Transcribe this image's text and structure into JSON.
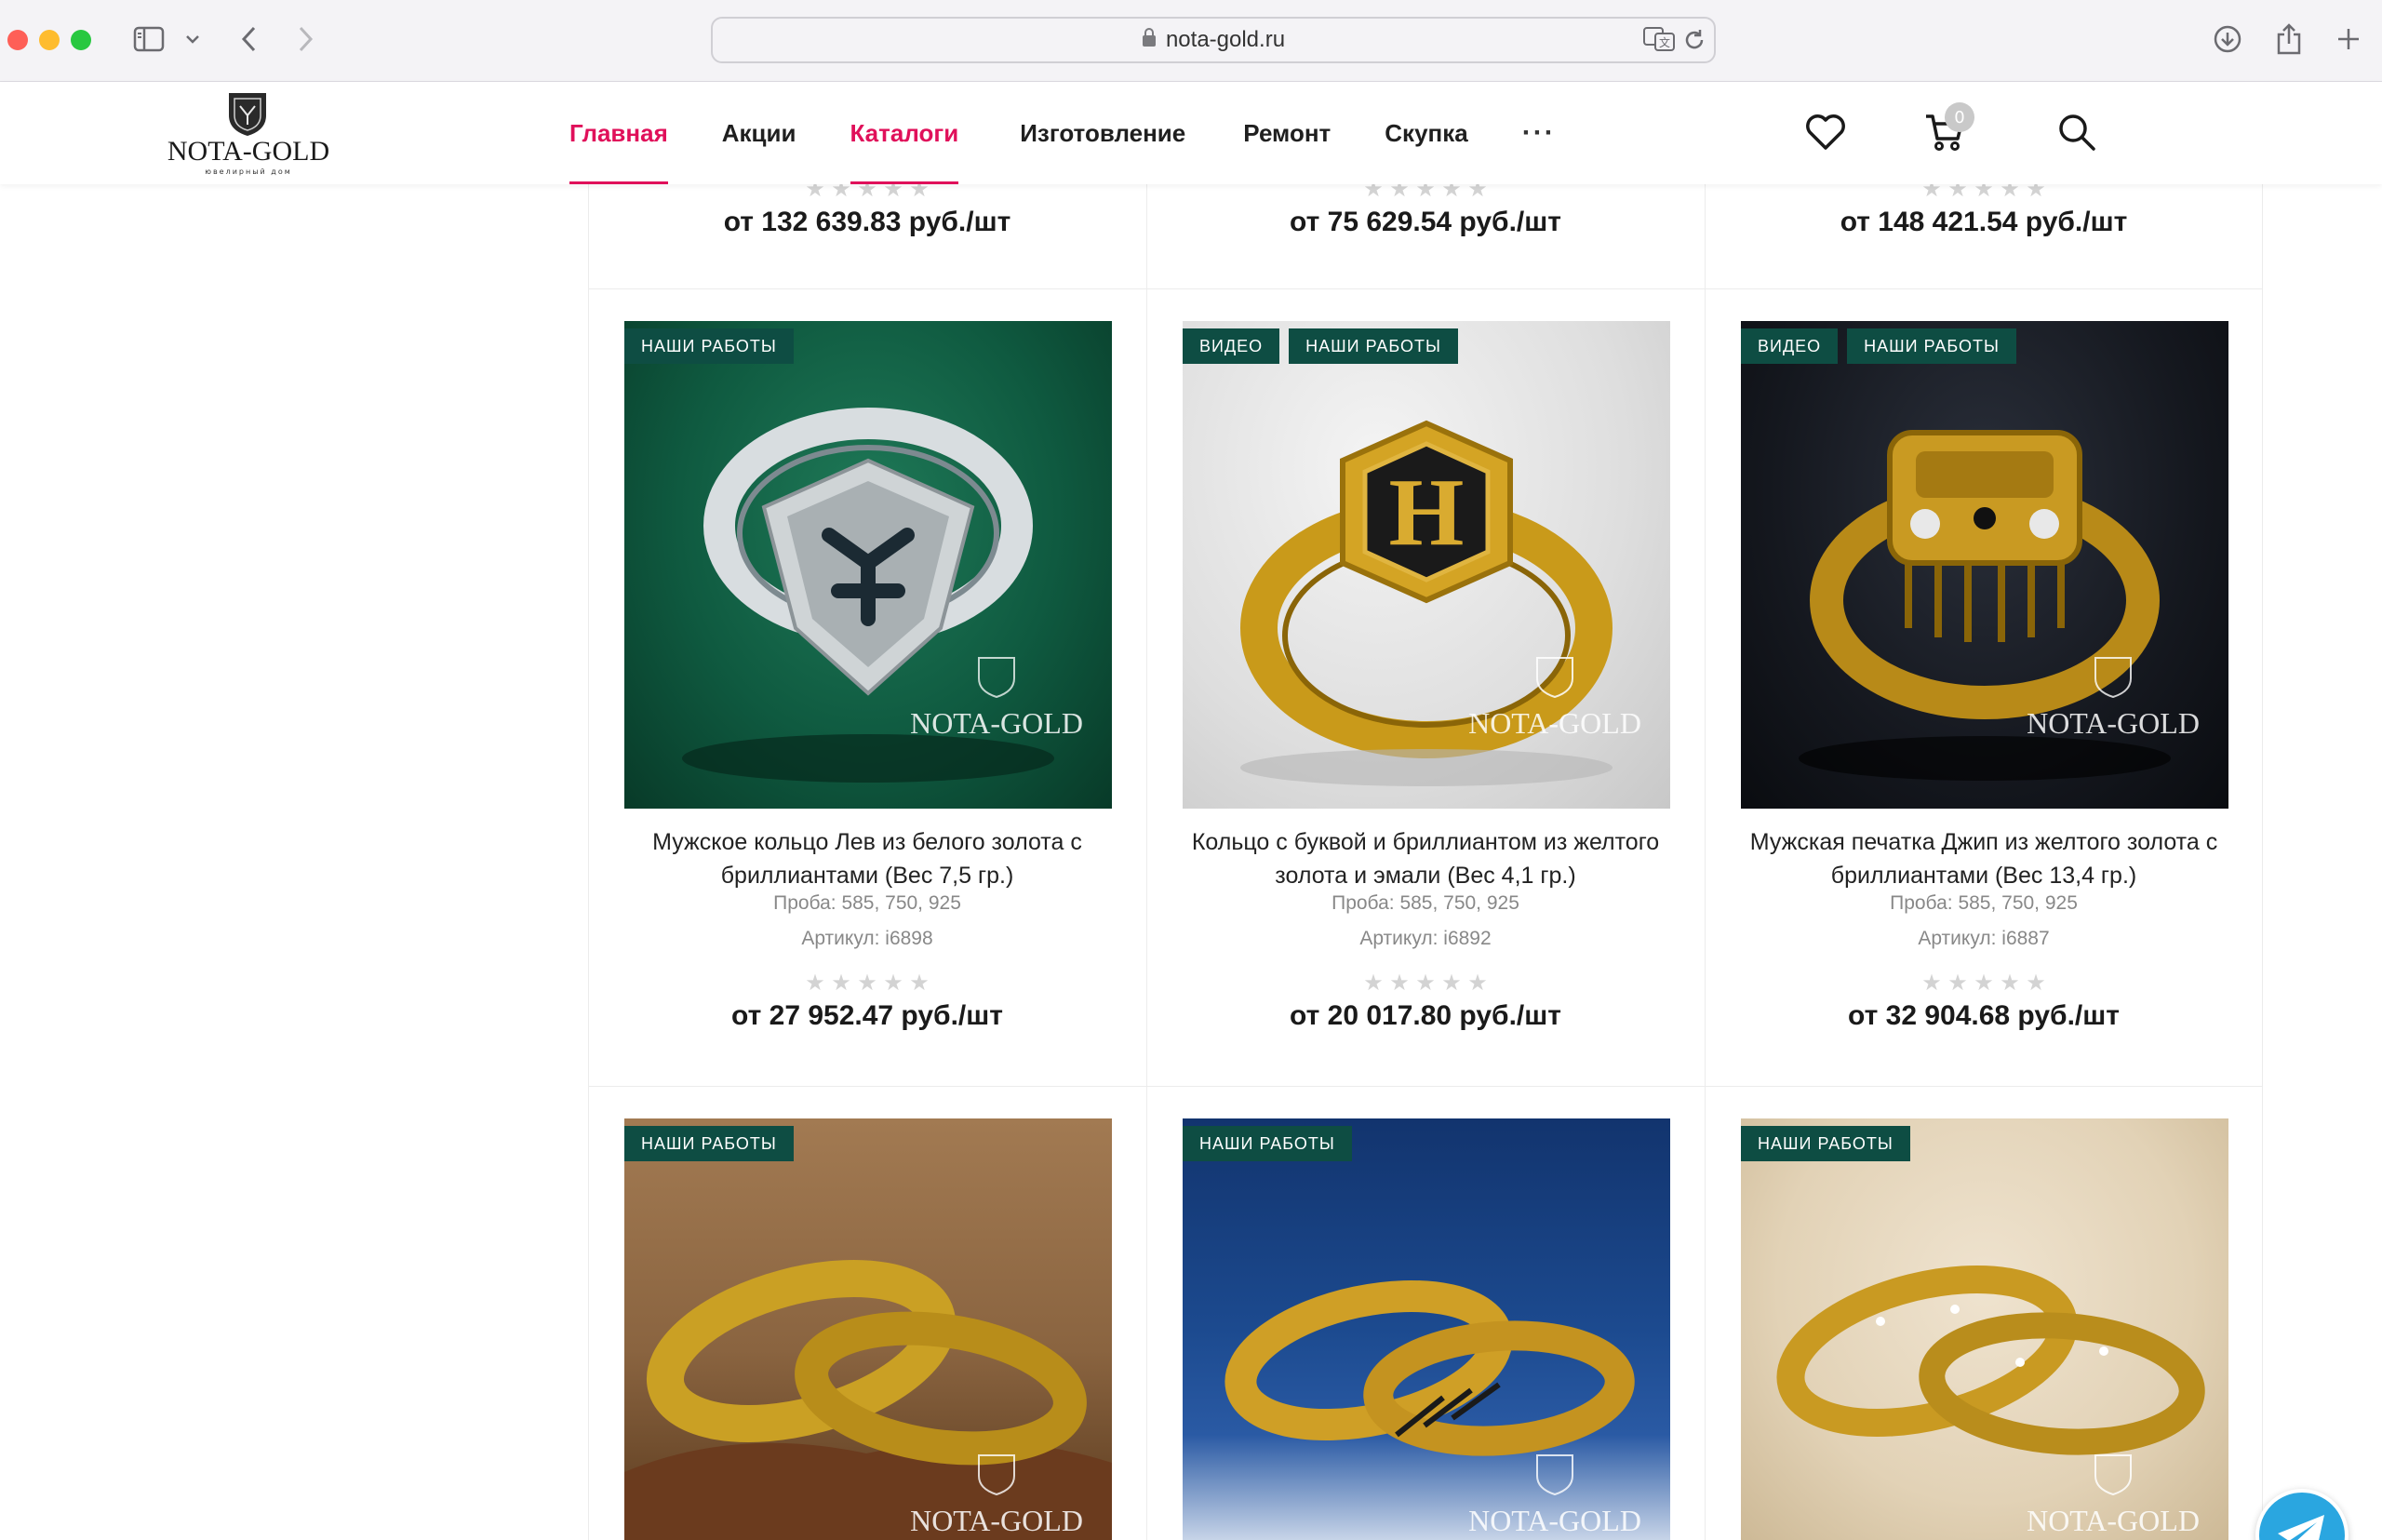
{
  "browser": {
    "url": "nota-gold.ru"
  },
  "header": {
    "logo": {
      "word": "NOTA-GOLD",
      "sub": "ювелирный дом"
    },
    "nav": [
      {
        "label": "Главная",
        "active": true
      },
      {
        "label": "Акции",
        "active": false
      },
      {
        "label": "Каталоги",
        "active": true
      },
      {
        "label": "Изготовление",
        "active": false
      },
      {
        "label": "Ремонт",
        "active": false
      },
      {
        "label": "Скупка",
        "active": false
      }
    ],
    "more": "···",
    "cart_count": "0"
  },
  "prev_prices": [
    "от 132 639.83 руб./шт",
    "от 75 629.54 руб./шт",
    "от 148 421.54 руб./шт"
  ],
  "products": [
    {
      "badges": [
        "НАШИ РАБОТЫ"
      ],
      "title": "Мужское кольцо Лев из белого золота с бриллиантами (Вес 7,5 гр.)",
      "proba": "Проба: 585, 750, 925",
      "article": "Артикул: i6898",
      "price": "от 27 952.47 руб./шт",
      "watermark": "NOTA-GOLD"
    },
    {
      "badges": [
        "ВИДЕО",
        "НАШИ РАБОТЫ"
      ],
      "title": "Кольцо с буквой и бриллиантом из желтого золота и эмали (Вес 4,1 гр.)",
      "proba": "Проба: 585, 750, 925",
      "article": "Артикул: i6892",
      "price": "от 20 017.80 руб./шт",
      "watermark": "NOTA-GOLD"
    },
    {
      "badges": [
        "ВИДЕО",
        "НАШИ РАБОТЫ"
      ],
      "title": "Мужская печатка Джип из желтого золота с бриллиантами (Вес 13,4 гр.)",
      "proba": "Проба: 585, 750, 925",
      "article": "Артикул: i6887",
      "price": "от 32 904.68 руб./шт",
      "watermark": "NOTA-GOLD"
    },
    {
      "badges": [
        "НАШИ РАБОТЫ"
      ],
      "watermark": "NOTA-GOLD"
    },
    {
      "badges": [
        "НАШИ РАБОТЫ"
      ],
      "watermark": "NOTA-GOLD"
    },
    {
      "badges": [
        "НАШИ РАБОТЫ"
      ],
      "watermark": "NOTA-GOLD"
    }
  ],
  "colors": {
    "accent": "#e0105a",
    "badge": "#0e4d43",
    "telegram": "#2aa6e0"
  }
}
